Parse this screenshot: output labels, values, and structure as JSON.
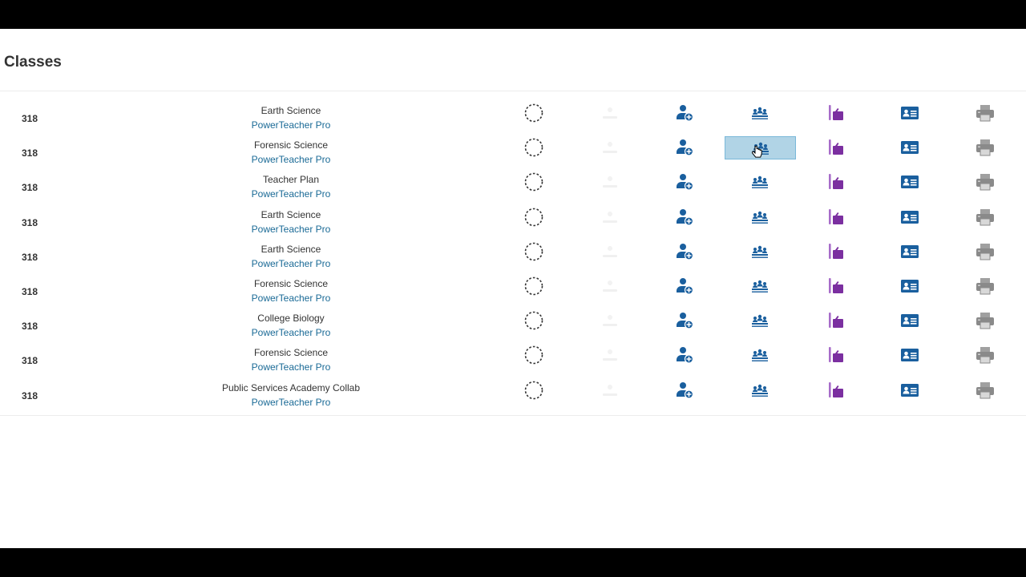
{
  "page": {
    "title": "Classes"
  },
  "classes": [
    {
      "room": "318",
      "course": "Earth Science",
      "link": "PowerTeacher Pro"
    },
    {
      "room": "318",
      "course": "Forensic Science",
      "link": "PowerTeacher Pro"
    },
    {
      "room": "318",
      "course": "Teacher Plan",
      "link": "PowerTeacher Pro"
    },
    {
      "room": "318",
      "course": "Earth Science",
      "link": "PowerTeacher Pro"
    },
    {
      "room": "318",
      "course": "Earth Science",
      "link": "PowerTeacher Pro"
    },
    {
      "room": "318",
      "course": "Forensic Science",
      "link": "PowerTeacher Pro"
    },
    {
      "room": "318",
      "course": "College Biology",
      "link": "PowerTeacher Pro"
    },
    {
      "room": "318",
      "course": "Forensic Science",
      "link": "PowerTeacher Pro"
    },
    {
      "room": "318",
      "course": "Public Services Academy Collab",
      "link": "PowerTeacher Pro"
    }
  ],
  "row_icons": [
    "attendance-icon",
    "faded-icon",
    "add-student-icon",
    "roster-icon",
    "tools-icon",
    "id-card-icon",
    "print-icon"
  ],
  "selected_row": 1,
  "selected_column": "roster-icon",
  "colors": {
    "blue": "#1a5f9e",
    "purple": "#7b2fa0",
    "link": "#1a6a96",
    "gray": "#8a8a8a"
  }
}
